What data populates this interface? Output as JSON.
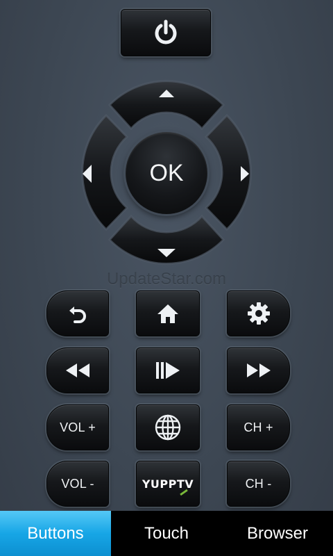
{
  "remote": {
    "ok_label": "OK",
    "vol_up_label": "VOL +",
    "vol_down_label": "VOL -",
    "ch_up_label": "CH +",
    "ch_down_label": "CH -",
    "yupptv_label": "YUPPTV"
  },
  "watermark": "UpdateStar.com",
  "tabs": [
    {
      "label": "Buttons",
      "active": true
    },
    {
      "label": "Touch",
      "active": false
    },
    {
      "label": "Browser",
      "active": false
    }
  ],
  "colors": {
    "tab_active": "#17a6e6",
    "background": "#3d4753",
    "yupptv_v_accent": "#7ab83a"
  },
  "icons": {
    "power": "power-icon",
    "back": "back-arrow-icon",
    "home": "home-icon",
    "settings": "gear-icon",
    "rewind": "rewind-icon",
    "play_pause": "play-pause-icon",
    "fast_forward": "fast-forward-icon",
    "browser": "globe-icon"
  }
}
